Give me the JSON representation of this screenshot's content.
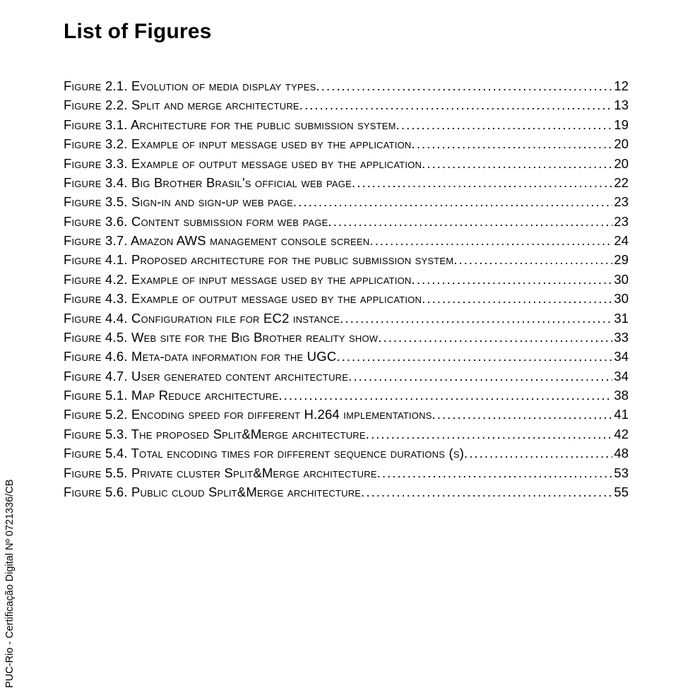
{
  "title": "List of Figures",
  "sidemark": "PUC-Rio - Certificação Digital Nº 0721336/CB",
  "entries": [
    {
      "label": "Figure 2.1. Evolution of media display types.",
      "page": "12"
    },
    {
      "label": "Figure 2.2. Split and merge architecture.",
      "page": "13"
    },
    {
      "label": "Figure 3.1. Architecture for the public submission system.",
      "page": "19"
    },
    {
      "label": "Figure 3.2. Example of input message used by the application.",
      "page": "20"
    },
    {
      "label": "Figure 3.3. Example of output message used by the application.",
      "page": "20"
    },
    {
      "label": "Figure 3.4. Big Brother Brasil's official web page.",
      "page": "22"
    },
    {
      "label": "Figure 3.5. Sign-in and sign-up web page.",
      "page": "23"
    },
    {
      "label": "Figure 3.6. Content submission form web page.",
      "page": "23"
    },
    {
      "label": "Figure 3.7. Amazon AWS management console screen.",
      "page": "24"
    },
    {
      "label": "Figure 4.1. Proposed architecture for the public submission system.",
      "page": "29"
    },
    {
      "label": "Figure 4.2. Example of input message used by the application.",
      "page": "30"
    },
    {
      "label": "Figure 4.3. Example of output message used by the application.",
      "page": "30"
    },
    {
      "label": "Figure 4.4. Configuration file for EC2 instance.",
      "page": "31"
    },
    {
      "label": "Figure 4.5. Web site for the Big Brother reality show.",
      "page": "33"
    },
    {
      "label": "Figure 4.6. Meta-data information for the UGC.",
      "page": "34"
    },
    {
      "label": "Figure 4.7. User generated content architecture.",
      "page": "34"
    },
    {
      "label": "Figure 5.1. Map Reduce architecture.",
      "page": "38"
    },
    {
      "label": "Figure 5.2. Encoding speed for different H.264 implementations.",
      "page": "41"
    },
    {
      "label": "Figure 5.3. The proposed Split&Merge architecture.",
      "page": "42"
    },
    {
      "label": "Figure 5.4. Total encoding times for different sequence durations (s).",
      "page": "48"
    },
    {
      "label": "Figure 5.5. Private cluster Split&Merge architecture.",
      "page": "53"
    },
    {
      "label": "Figure 5.6. Public cloud Split&Merge architecture.",
      "page": "55"
    }
  ]
}
